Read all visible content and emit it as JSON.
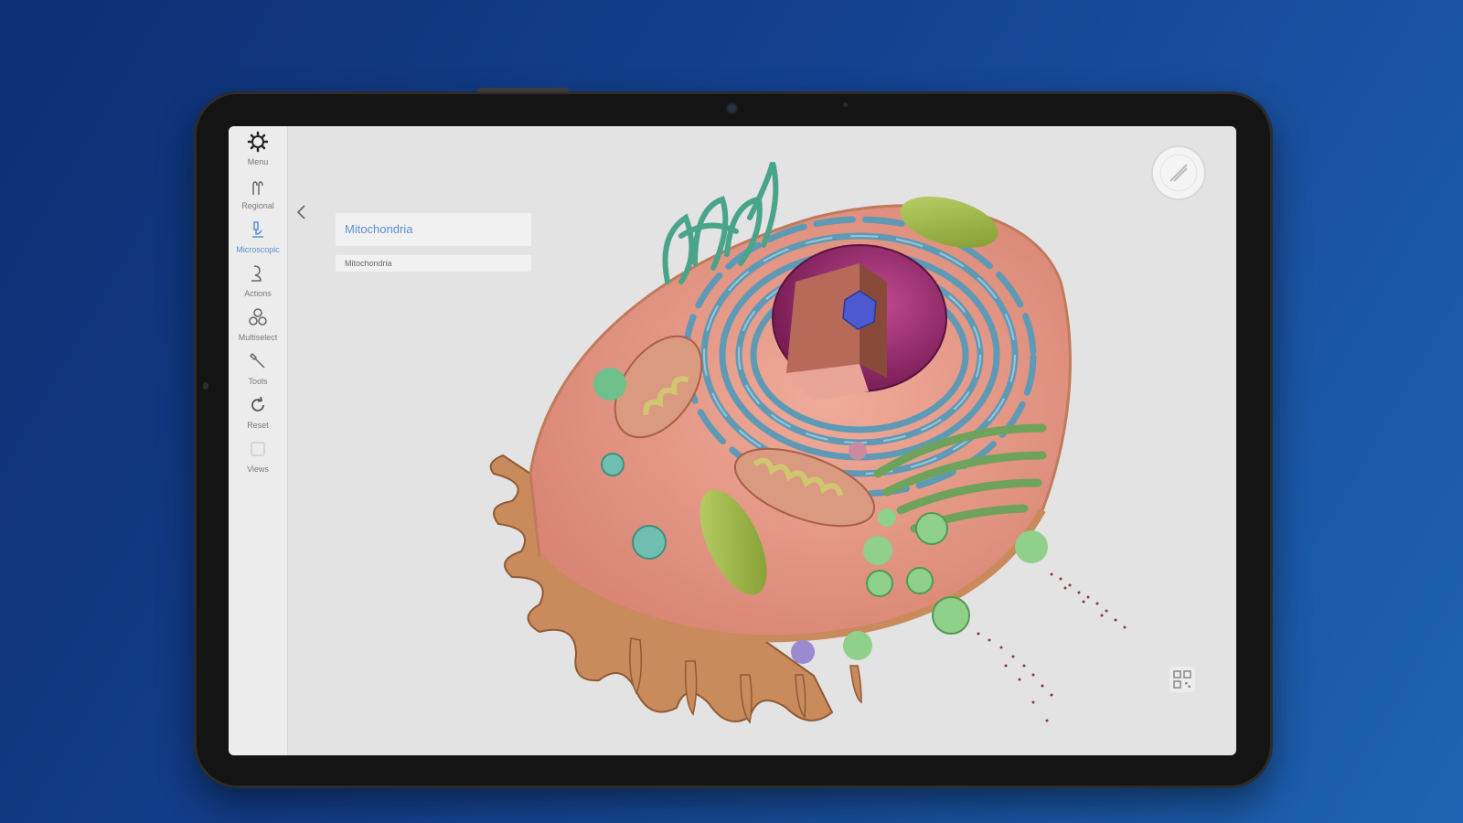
{
  "colors": {
    "background_start": "#0d2f73",
    "background_end": "#1e63b3",
    "screen_bg": "#e3e3e3",
    "accent": "#5d8fd0",
    "cytoplasm": "#e89a88",
    "er": "#6aa6bf",
    "nucleus": "#9c2a6f",
    "mitochondria": "#cdbf74",
    "golgi": "#7bb06a"
  },
  "sidebar": {
    "items": [
      {
        "label": "Menu",
        "icon": "gear-icon"
      },
      {
        "label": "Regional",
        "icon": "hands-icon"
      },
      {
        "label": "Microscopic",
        "icon": "microscope-icon"
      },
      {
        "label": "Actions",
        "icon": "actions-icon"
      },
      {
        "label": "Multiselect",
        "icon": "multiselect-icon"
      },
      {
        "label": "Tools",
        "icon": "tools-icon"
      },
      {
        "label": "Reset",
        "icon": "reset-icon"
      },
      {
        "label": "Views",
        "icon": "views-icon"
      }
    ],
    "collapse_icon": "chevron-left-icon"
  },
  "panel": {
    "title": "Mitochondria",
    "subtitle": "Mitochondria"
  },
  "viewer": {
    "model": "3D animal cell",
    "logo_icon": "compass-logo-icon",
    "qr_icon": "qr-code-icon"
  }
}
